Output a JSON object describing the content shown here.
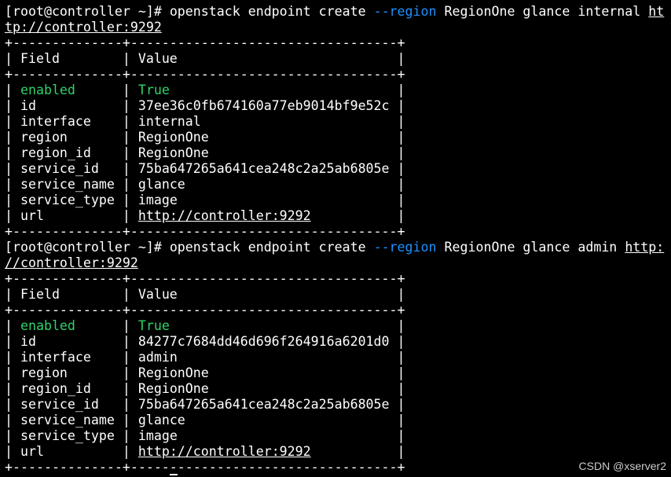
{
  "prompt": "[root@controller ~]#",
  "commands": [
    {
      "cmd_before": "openstack endpoint create",
      "option": "--region",
      "cmd_after": "RegionOne glance internal",
      "url_line1": "ht",
      "url_line2": "tp://controller:9292",
      "table": {
        "border": "+--------------+----------------------------------+",
        "header_field": "Field",
        "header_value": "Value",
        "rows": [
          {
            "field": "enabled",
            "value": "True"
          },
          {
            "field": "id",
            "value": "37ee36c0fb674160a77eb9014bf9e52c"
          },
          {
            "field": "interface",
            "value": "internal"
          },
          {
            "field": "region",
            "value": "RegionOne"
          },
          {
            "field": "region_id",
            "value": "RegionOne"
          },
          {
            "field": "service_id",
            "value": "75ba647265a641cea248c2a25ab6805e"
          },
          {
            "field": "service_name",
            "value": "glance"
          },
          {
            "field": "service_type",
            "value": "image"
          },
          {
            "field": "url",
            "value": "http://controller:9292"
          }
        ]
      }
    },
    {
      "cmd_before": "openstack endpoint create",
      "option": "--region",
      "cmd_after": "RegionOne glance admin",
      "url_line1": "http:",
      "url_line2": "//controller:9292",
      "table": {
        "border": "+--------------+----------------------------------+",
        "header_field": "Field",
        "header_value": "Value",
        "rows": [
          {
            "field": "enabled",
            "value": "True"
          },
          {
            "field": "id",
            "value": "84277c7684dd46d696f264916a6201d0"
          },
          {
            "field": "interface",
            "value": "admin"
          },
          {
            "field": "region",
            "value": "RegionOne"
          },
          {
            "field": "region_id",
            "value": "RegionOne"
          },
          {
            "field": "service_id",
            "value": "75ba647265a641cea248c2a25ab6805e"
          },
          {
            "field": "service_name",
            "value": "glance"
          },
          {
            "field": "service_type",
            "value": "image"
          },
          {
            "field": "url",
            "value": "http://controller:9292"
          }
        ]
      }
    }
  ],
  "watermark": "CSDN @xserver2",
  "colors": {
    "background": "#000000",
    "text": "#ffffff",
    "option": "#1e90ff",
    "enabled_highlight": "#2ed36a"
  }
}
